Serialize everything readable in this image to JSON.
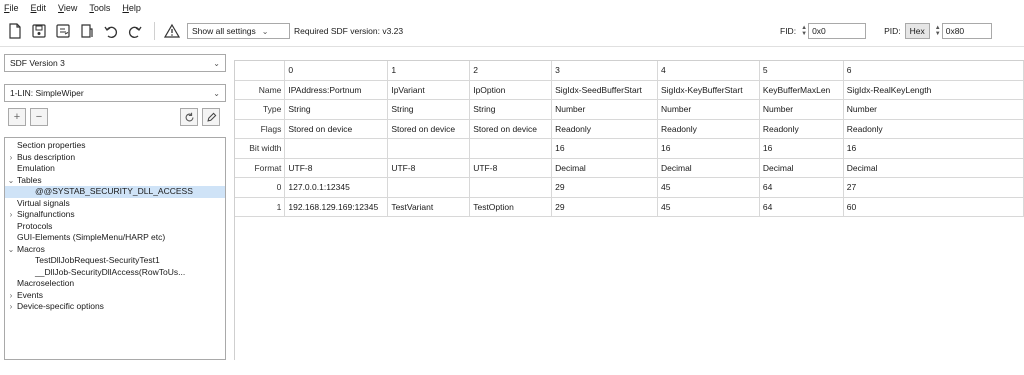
{
  "menu": [
    "File",
    "Edit",
    "View",
    "Tools",
    "Help"
  ],
  "toolbar": {
    "settings_combo": "Show all settings",
    "sdf_version_text": "Required SDF version: v3.23",
    "fid_label": "FID:",
    "fid_value": "0x0",
    "pid_label": "PID:",
    "pid_mode": "Hex",
    "pid_value": "0x80"
  },
  "left_panel": {
    "sdf_combo": "SDF Version 3",
    "lin_combo": "1-LIN: SimpleWiper",
    "tree": [
      {
        "label": "Section properties",
        "indent": 0,
        "twisty": ""
      },
      {
        "label": "Bus description",
        "indent": 0,
        "twisty": "›"
      },
      {
        "label": "Emulation",
        "indent": 0,
        "twisty": ""
      },
      {
        "label": "Tables",
        "indent": 0,
        "twisty": "⌄"
      },
      {
        "label": "@@SYSTAB_SECURITY_DLL_ACCESS",
        "indent": 2,
        "twisty": "",
        "selected": true
      },
      {
        "label": "Virtual signals",
        "indent": 0,
        "twisty": ""
      },
      {
        "label": "Signalfunctions",
        "indent": 0,
        "twisty": "›"
      },
      {
        "label": "Protocols",
        "indent": 0,
        "twisty": ""
      },
      {
        "label": "GUI-Elements (SimpleMenu/HARP etc)",
        "indent": 0,
        "twisty": ""
      },
      {
        "label": "Macros",
        "indent": 0,
        "twisty": "⌄"
      },
      {
        "label": "TestDllJobRequest-SecurityTest1",
        "indent": 2,
        "twisty": ""
      },
      {
        "label": "__DllJob-SecurityDllAccess(RowToUs...",
        "indent": 2,
        "twisty": ""
      },
      {
        "label": "Macroselection",
        "indent": 0,
        "twisty": ""
      },
      {
        "label": "Events",
        "indent": 0,
        "twisty": "›"
      },
      {
        "label": "Device-specific options",
        "indent": 0,
        "twisty": "›"
      }
    ]
  },
  "grid": {
    "column_numbers": [
      "0",
      "1",
      "2",
      "3",
      "4",
      "5",
      "6"
    ],
    "rows": [
      {
        "header": "Name",
        "cells": [
          "IPAddress:Portnum",
          "IpVariant",
          "IpOption",
          "SigIdx-SeedBufferStart",
          "SigIdx-KeyBufferStart",
          "KeyBufferMaxLen",
          "SigIdx-RealKeyLength"
        ]
      },
      {
        "header": "Type",
        "cells": [
          "String",
          "String",
          "String",
          "Number",
          "Number",
          "Number",
          "Number"
        ]
      },
      {
        "header": "Flags",
        "cells": [
          "Stored on device",
          "Stored on device",
          "Stored on device",
          "Readonly",
          "Readonly",
          "Readonly",
          "Readonly"
        ]
      },
      {
        "header": "Bit width",
        "cells": [
          "",
          "",
          "",
          "16",
          "16",
          "16",
          "16"
        ]
      },
      {
        "header": "Format",
        "cells": [
          "UTF-8",
          "UTF-8",
          "UTF-8",
          "Decimal",
          "Decimal",
          "Decimal",
          "Decimal"
        ]
      },
      {
        "header": "0",
        "cells": [
          "127.0.0.1:12345",
          "",
          "",
          "29",
          "45",
          "64",
          "27"
        ]
      },
      {
        "header": "1",
        "cells": [
          "192.168.129.169:12345",
          "TestVariant",
          "TestOption",
          "29",
          "45",
          "64",
          "60"
        ]
      }
    ]
  }
}
